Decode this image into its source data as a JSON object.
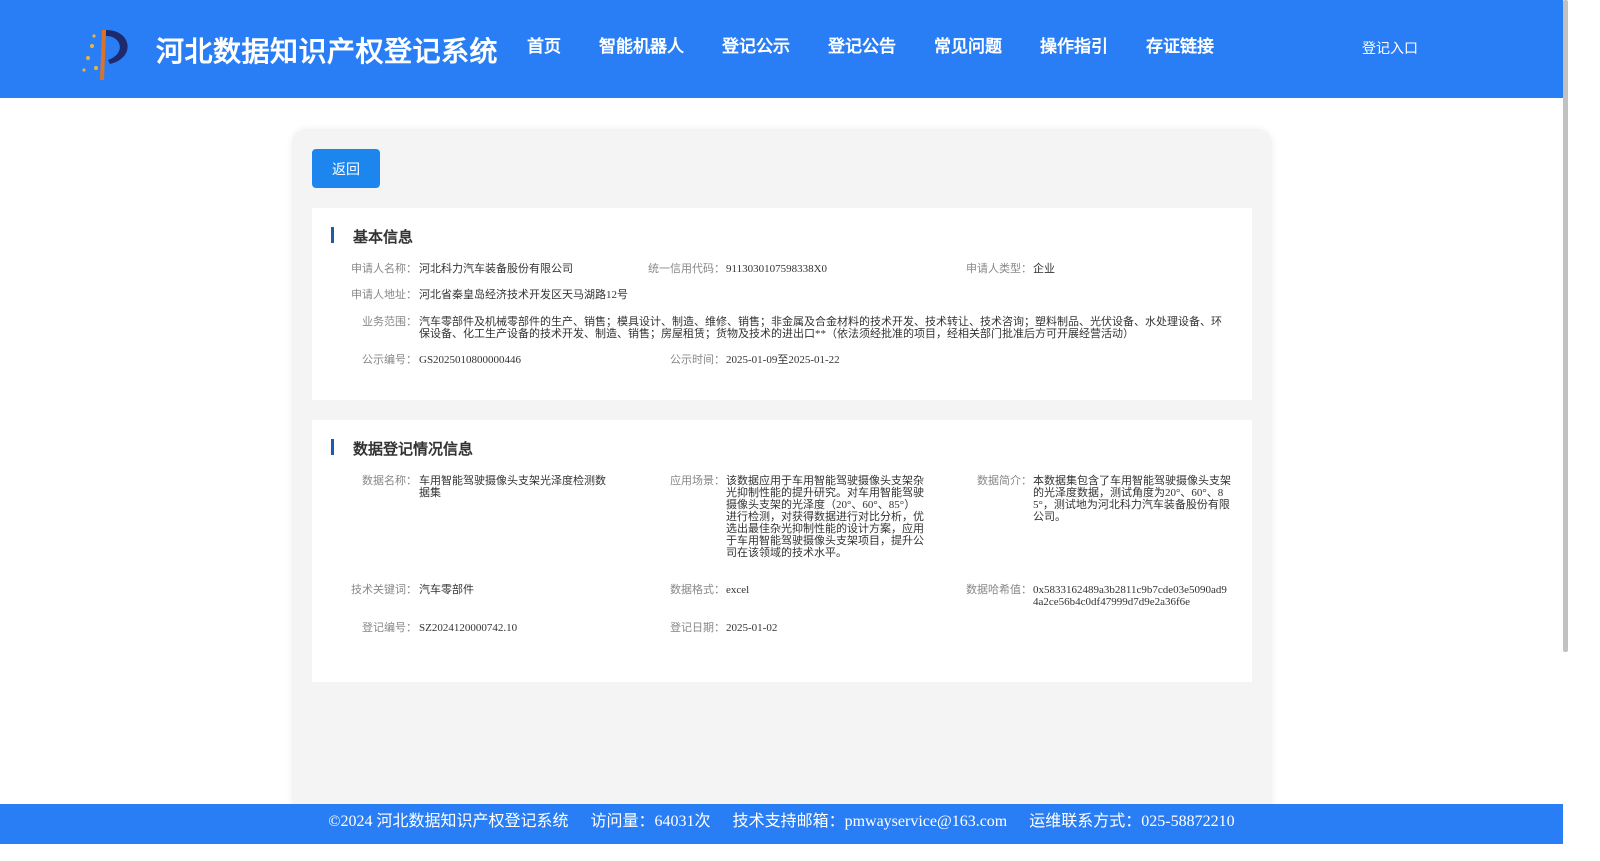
{
  "header": {
    "site_title": "河北数据知识产权登记系统",
    "nav": [
      "首页",
      "智能机器人",
      "登记公示",
      "登记公告",
      "常见问题",
      "操作指引",
      "存证链接"
    ],
    "login_label": "登记入口"
  },
  "back_label": "返回",
  "basic_info": {
    "title": "基本信息",
    "applicant_name_label": "申请人名称：",
    "applicant_name": "河北科力汽车装备股份有限公司",
    "credit_code_label": "统一信用代码：",
    "credit_code": "9113030107598338X0",
    "applicant_type_label": "申请人类型：",
    "applicant_type": "企业",
    "address_label": "申请人地址：",
    "address": "河北省秦皇岛经济技术开发区天马湖路12号",
    "business_scope_label": "业务范围：",
    "business_scope": "汽车零部件及机械零部件的生产、销售；模具设计、制造、维修、销售；非金属及合金材料的技术开发、技术转让、技术咨询；塑料制品、光伏设备、水处理设备、环保设备、化工生产设备的技术开发、制造、销售；房屋租赁；货物及技术的进出口**（依法须经批准的项目，经相关部门批准后方可开展经营活动）",
    "publicity_no_label": "公示编号：",
    "publicity_no": "GS2025010800000446",
    "publicity_time_label": "公示时间：",
    "publicity_time": "2025-01-09至2025-01-22"
  },
  "data_info": {
    "title": "数据登记情况信息",
    "data_name_label": "数据名称：",
    "data_name": "车用智能驾驶摄像头支架光泽度检测数据集",
    "scenario_label": "应用场景：",
    "scenario": "该数据应用于车用智能驾驶摄像头支架杂光抑制性能的提升研究。对车用智能驾驶摄像头支架的光泽度（20°、60°、85°）进行检测，对获得数据进行对比分析，优选出最佳杂光抑制性能的设计方案，应用于车用智能驾驶摄像头支架项目，提升公司在该领域的技术水平。",
    "summary_label": "数据简介：",
    "summary": "本数据集包含了车用智能驾驶摄像头支架的光泽度数据，测试角度为20°、60°、85°，测试地为河北科力汽车装备股份有限公司。",
    "keywords_label": "技术关键词：",
    "keywords": "汽车零部件",
    "format_label": "数据格式：",
    "format": "excel",
    "hash_label": "数据哈希值：",
    "hash": "0x5833162489a3b2811c9b7cde03e5090ad94a2ce56b4c0df47999d7d9e2a36f6e",
    "reg_no_label": "登记编号：",
    "reg_no": "SZ2024120000742.10",
    "reg_date_label": "登记日期：",
    "reg_date": "2025-01-02"
  },
  "footer": {
    "copyright": "©2024 河北数据知识产权登记系统",
    "visits": "访问量：64031次",
    "email": "技术支持邮箱：pmwayservice@163.com",
    "contact": "运维联系方式：025-58872210"
  }
}
